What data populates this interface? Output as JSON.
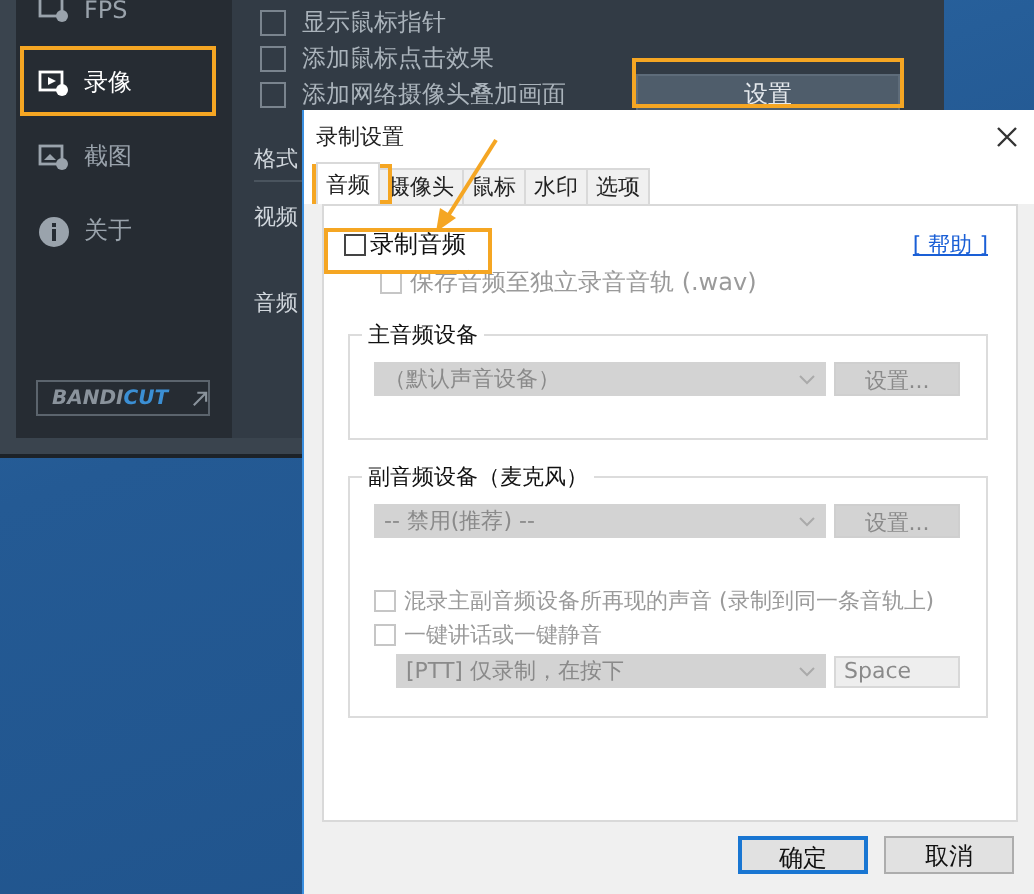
{
  "app_window": {
    "sidebar": {
      "items": [
        {
          "label": "FPS",
          "kind": "fps",
          "selected": false
        },
        {
          "label": "录像",
          "kind": "video",
          "selected": true
        },
        {
          "label": "截图",
          "kind": "image",
          "selected": false
        },
        {
          "label": "关于",
          "kind": "info",
          "selected": false
        }
      ],
      "logo": {
        "part_1": "BANDI",
        "part_2": "CUT"
      }
    },
    "options": [
      {
        "label": "显示鼠标指针",
        "checked": false
      },
      {
        "label": "添加鼠标点击效果",
        "checked": false
      },
      {
        "label": "添加网络摄像头叠加画面",
        "checked": false
      }
    ],
    "settings_button": "设置",
    "sections": [
      "格式",
      "视频",
      "音频"
    ]
  },
  "dialog": {
    "title": "录制设置",
    "tabs": [
      {
        "label": "音频",
        "selected": true
      },
      {
        "label": "摄像头",
        "selected": false
      },
      {
        "label": "鼠标",
        "selected": false
      },
      {
        "label": "水印",
        "selected": false
      },
      {
        "label": "选项",
        "selected": false
      }
    ],
    "record_audio": {
      "label": "录制音频",
      "checked": false
    },
    "help_link": "[ 帮助 ]",
    "save_separate": {
      "label": "保存音频至独立录音音轨 (.wav)",
      "checked": false,
      "disabled": true
    },
    "primary_device": {
      "legend": "主音频设备",
      "select": "（默认声音设备）",
      "button": "设置...",
      "disabled": true
    },
    "secondary_device": {
      "legend": "副音频设备（麦克风）",
      "select": "-- 禁用(推荐) --",
      "button": "设置...",
      "disabled": true,
      "options": [
        {
          "label": "混录主副音频设备所再现的声音 (录制到同一条音轨上)",
          "checked": false,
          "disabled": true
        },
        {
          "label": "一键讲话或一键静音",
          "checked": false,
          "disabled": true
        }
      ],
      "ptt_select": "[PTT] 仅录制，在按下",
      "hotkey": "Space"
    },
    "buttons": [
      {
        "label": "确定",
        "default": true
      },
      {
        "label": "取消",
        "default": false
      }
    ]
  }
}
